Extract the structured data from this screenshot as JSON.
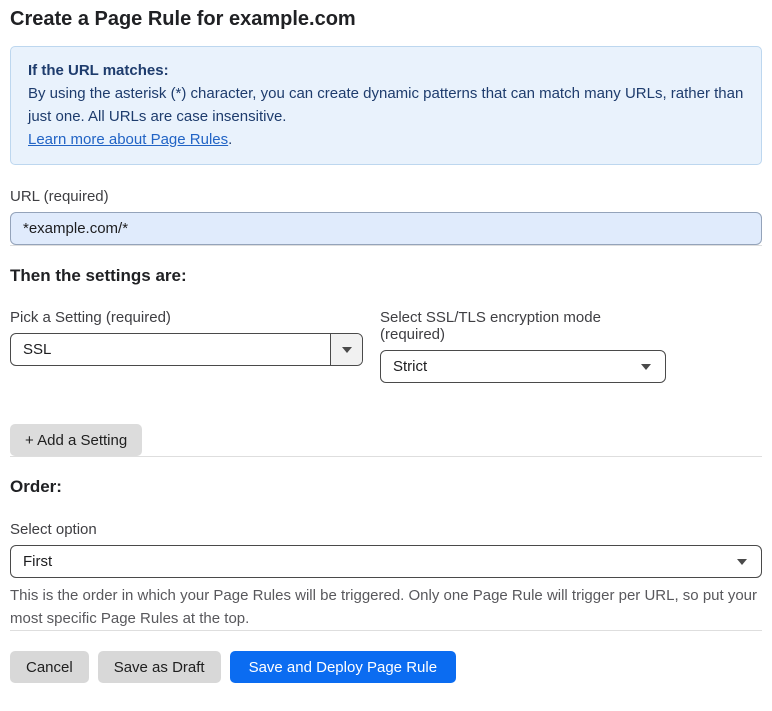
{
  "page": {
    "title": "Create a Page Rule for example.com"
  },
  "info_box": {
    "heading": "If the URL matches:",
    "body": "By using the asterisk (*) character, you can create dynamic patterns that can match many URLs, rather than just one. All URLs are case insensitive.",
    "link_label": "Learn more about Page Rules",
    "link_suffix": "."
  },
  "url_field": {
    "label": "URL (required)",
    "value": "*example.com/*"
  },
  "settings_section": {
    "heading": "Then the settings are:",
    "setting_select": {
      "label": "Pick a Setting (required)",
      "value": "SSL"
    },
    "mode_select": {
      "label": "Select SSL/TLS encryption mode (required)",
      "value": "Strict"
    },
    "add_setting_label": "+ Add a Setting"
  },
  "order_section": {
    "heading": "Order:",
    "select_label": "Select option",
    "select_value": "First",
    "help_text": "This is the order in which your Page Rules will be triggered. Only one Page Rule will trigger per URL, so put your most specific Page Rules at the top."
  },
  "footer": {
    "cancel_label": "Cancel",
    "save_draft_label": "Save as Draft",
    "save_deploy_label": "Save and Deploy Page Rule"
  },
  "icons": {
    "dropdown_arrow": "triangle-down"
  },
  "colors": {
    "accent_blue": "#0b6cf1",
    "info_background": "#e9f2fc",
    "info_border": "#bdd7ef",
    "info_text": "#1e3c6d",
    "link_blue": "#2264c5",
    "input_background": "#e0ebfc",
    "button_gray": "#d8d8d8",
    "select_border": "#4a4a4a"
  }
}
